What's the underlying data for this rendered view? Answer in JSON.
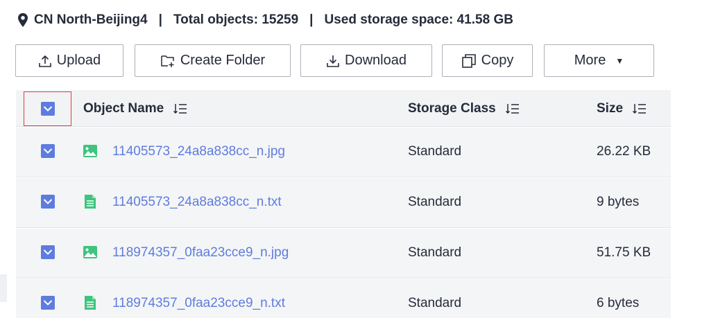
{
  "info": {
    "region": "CN North-Beijing4",
    "separator": "|",
    "total_objects": "Total objects: 15259",
    "used_storage": "Used storage space: 41.58 GB"
  },
  "toolbar": {
    "upload_label": "Upload",
    "create_folder_label": "Create Folder",
    "download_label": "Download",
    "copy_label": "Copy",
    "more_label": "More"
  },
  "table": {
    "headers": {
      "object_name": "Object Name",
      "storage_class": "Storage Class",
      "size": "Size"
    },
    "select_all_checked": true,
    "rows": [
      {
        "name": "11405573_24a8a838cc_n.jpg",
        "type": "image",
        "storage_class": "Standard",
        "size": "26.22 KB",
        "checked": true
      },
      {
        "name": "11405573_24a8a838cc_n.txt",
        "type": "text",
        "storage_class": "Standard",
        "size": "9 bytes",
        "checked": true
      },
      {
        "name": "118974357_0faa23cce9_n.jpg",
        "type": "image",
        "storage_class": "Standard",
        "size": "51.75 KB",
        "checked": true
      },
      {
        "name": "118974357_0faa23cce9_n.txt",
        "type": "text",
        "storage_class": "Standard",
        "size": "6 bytes",
        "checked": true
      }
    ]
  },
  "colors": {
    "accent": "#5e7ce0",
    "file_icon_green": "#3ec47e",
    "highlight_border": "#e3393c",
    "text": "#252b3a",
    "header_bg": "#f2f3f5",
    "row_bg": "#f4f5f6"
  },
  "icons": {
    "region": "location-pin-icon",
    "upload": "upload-icon",
    "create_folder": "create-folder-icon",
    "download": "download-icon",
    "copy": "copy-icon",
    "more": "caret-down-icon",
    "sort": "sort-icon",
    "image_file": "image-file-icon",
    "text_file": "text-file-icon"
  }
}
